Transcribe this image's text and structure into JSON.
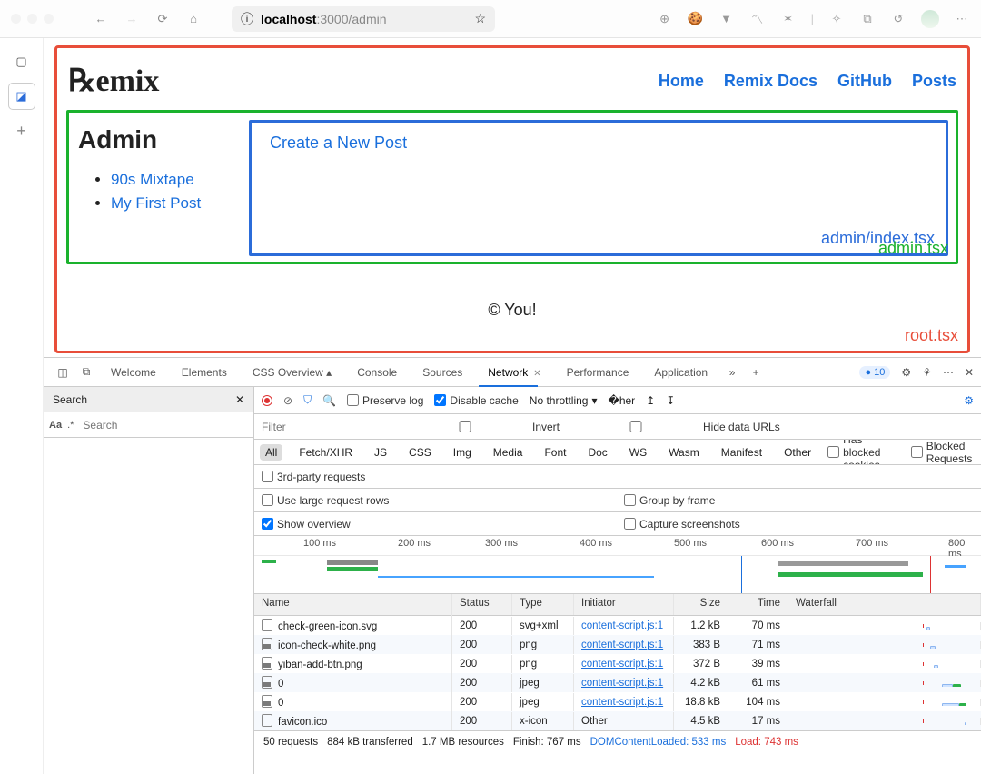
{
  "browser": {
    "url_host": "localhost",
    "url_path": ":3000/admin"
  },
  "page": {
    "logo": "℞emix",
    "nav": [
      "Home",
      "Remix Docs",
      "GitHub",
      "Posts"
    ],
    "admin_heading": "Admin",
    "posts": [
      "90s Mixtape",
      "My First Post"
    ],
    "create_link": "Create a New Post",
    "footer": "© You!",
    "labels": {
      "root": "root.tsx",
      "admin": "admin.tsx",
      "index": "admin/index.tsx"
    }
  },
  "devtools": {
    "tabs": [
      "Welcome",
      "Elements",
      "CSS Overview ▴",
      "Console",
      "Sources",
      "Network",
      "Performance",
      "Application"
    ],
    "active_tab": "Network",
    "issue_count": "10",
    "search": {
      "title": "Search",
      "placeholder": "Search",
      "aa": "Aa",
      "regex": ".*"
    },
    "toolbar": {
      "preserve_log": "Preserve log",
      "disable_cache": "Disable cache",
      "throttling": "No throttling"
    },
    "filter": {
      "placeholder": "Filter",
      "invert": "Invert",
      "hide_data_urls": "Hide data URLs"
    },
    "types": [
      "All",
      "Fetch/XHR",
      "JS",
      "CSS",
      "Img",
      "Media",
      "Font",
      "Doc",
      "WS",
      "Wasm",
      "Manifest",
      "Other"
    ],
    "type_opts": {
      "blocked_cookies": "Has blocked cookies",
      "blocked_requests": "Blocked Requests"
    },
    "third_party": "3rd-party requests",
    "opt_rows": {
      "large_rows": "Use large request rows",
      "group_by_frame": "Group by frame",
      "show_overview": "Show overview",
      "screenshots": "Capture screenshots"
    },
    "timeline_ticks": [
      "100 ms",
      "200 ms",
      "300 ms",
      "400 ms",
      "500 ms",
      "600 ms",
      "700 ms",
      "800 ms"
    ],
    "columns": [
      "Name",
      "Status",
      "Type",
      "Initiator",
      "Size",
      "Time",
      "Waterfall"
    ],
    "rows": [
      {
        "name": "check-green-icon.svg",
        "status": "200",
        "type": "svg+xml",
        "init": "content-script.js:1",
        "size": "1.2 kB",
        "time": "70 ms",
        "wf": {
          "l": 72,
          "w": 2,
          "green": false
        }
      },
      {
        "name": "icon-check-white.png",
        "status": "200",
        "type": "png",
        "init": "content-script.js:1",
        "size": "383 B",
        "time": "71 ms",
        "wf": {
          "l": 74,
          "w": 3,
          "green": false
        }
      },
      {
        "name": "yiban-add-btn.png",
        "status": "200",
        "type": "png",
        "init": "content-script.js:1",
        "size": "372 B",
        "time": "39 ms",
        "wf": {
          "l": 76,
          "w": 2,
          "green": false
        }
      },
      {
        "name": "0",
        "status": "200",
        "type": "jpeg",
        "init": "content-script.js:1",
        "size": "4.2 kB",
        "time": "61 ms",
        "wf": {
          "l": 80,
          "w": 6,
          "green": true
        }
      },
      {
        "name": "0",
        "status": "200",
        "type": "jpeg",
        "init": "content-script.js:1",
        "size": "18.8 kB",
        "time": "104 ms",
        "wf": {
          "l": 80,
          "w": 9,
          "green": true
        }
      },
      {
        "name": "favicon.ico",
        "status": "200",
        "type": "x-icon",
        "init": "Other",
        "size": "4.5 kB",
        "time": "17 ms",
        "wf": {
          "l": 92,
          "w": 1,
          "green": false
        }
      }
    ],
    "status_bar": {
      "requests": "50 requests",
      "transferred": "884 kB transferred",
      "resources": "1.7 MB resources",
      "finish": "Finish: 767 ms",
      "dom": "DOMContentLoaded: 533 ms",
      "load": "Load: 743 ms"
    }
  }
}
